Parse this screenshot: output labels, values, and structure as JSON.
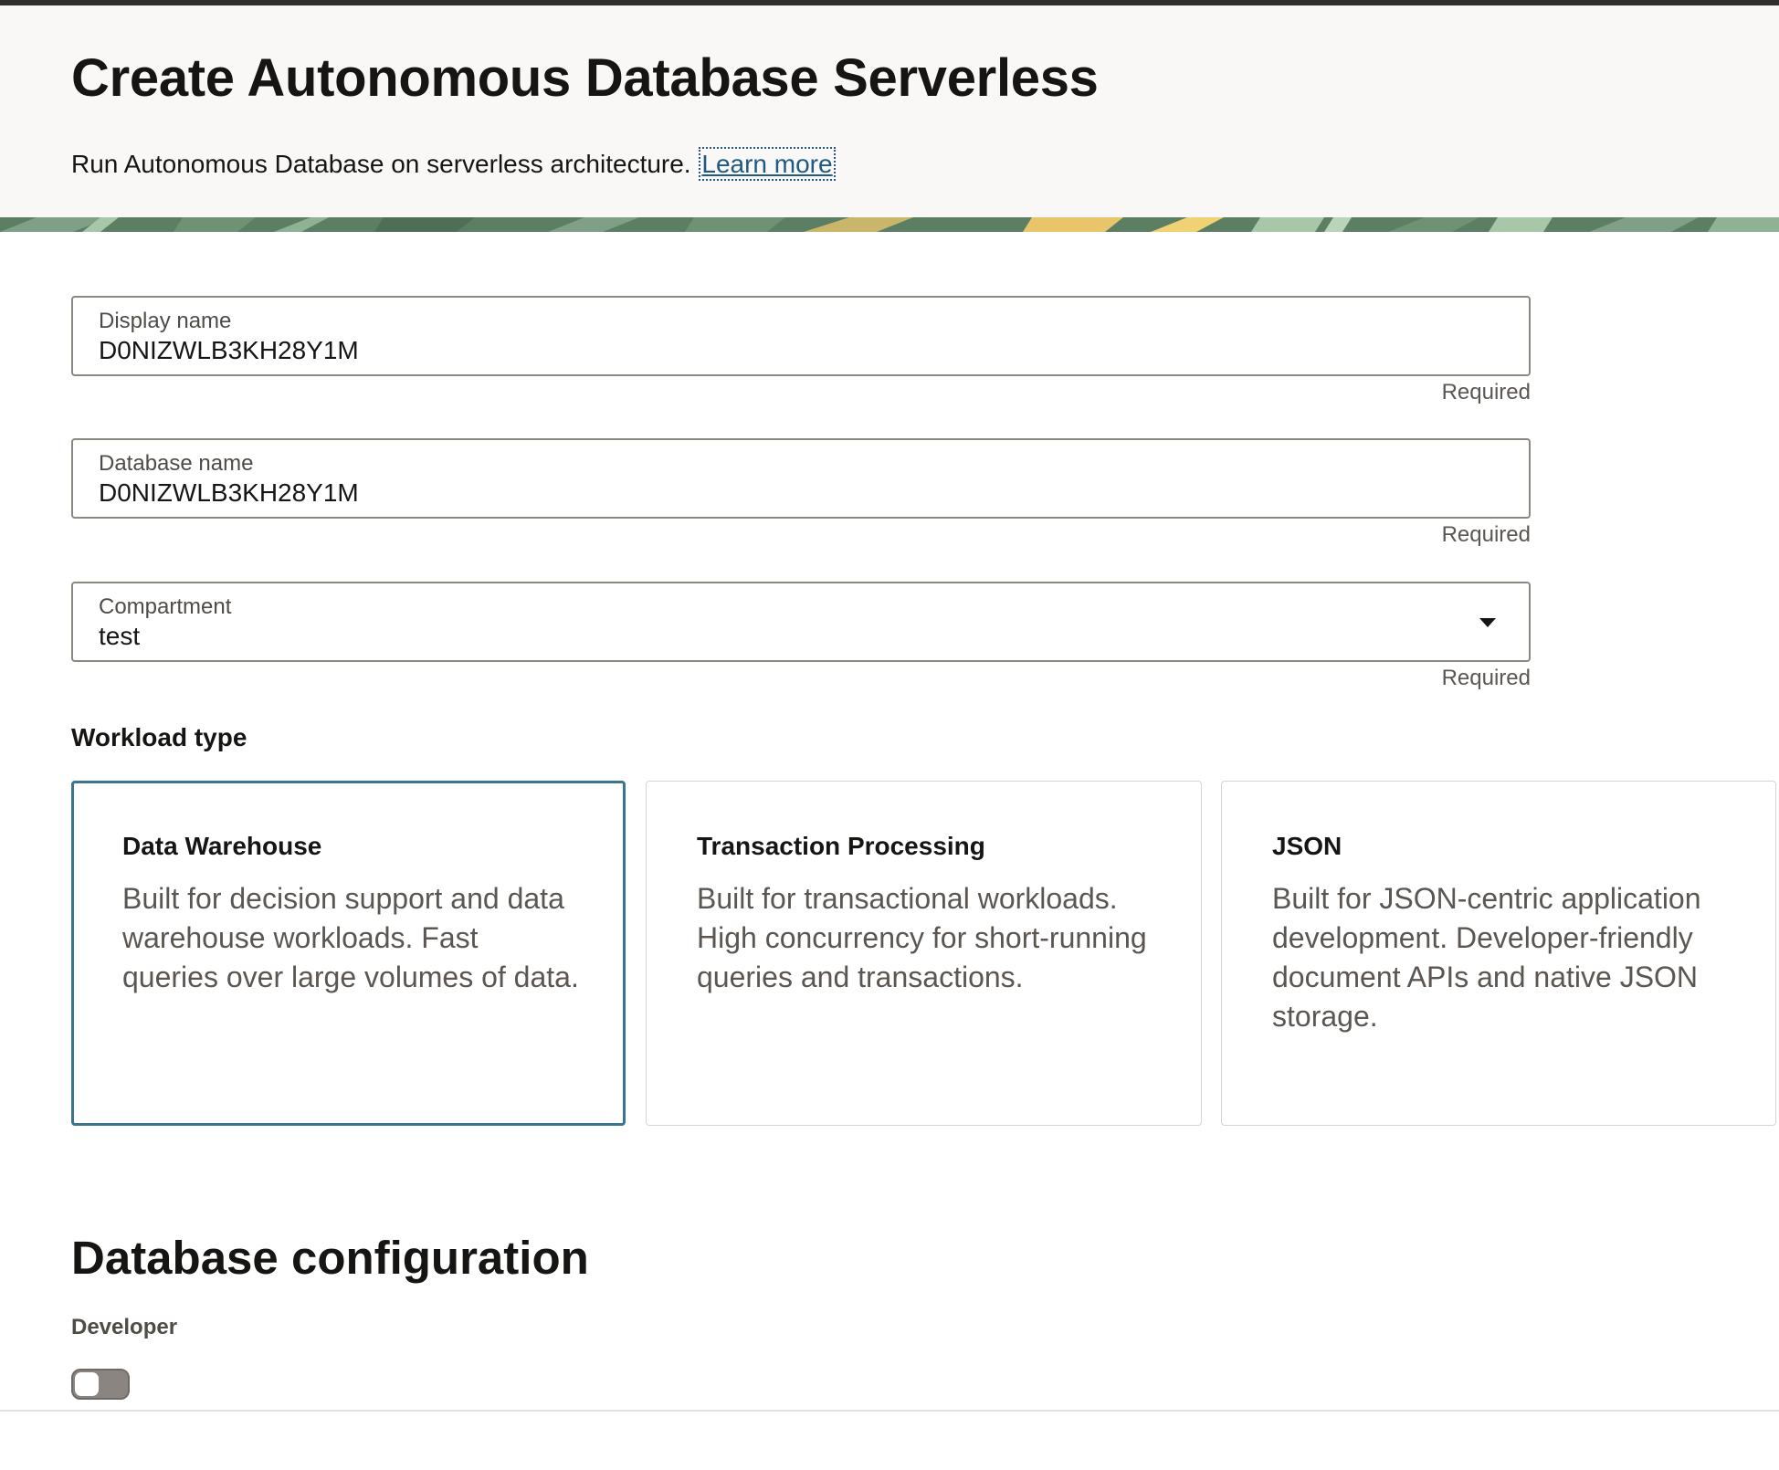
{
  "header": {
    "title": "Create Autonomous Database Serverless",
    "subtitle": "Run Autonomous Database on serverless architecture.",
    "learn_more": "Learn more"
  },
  "form": {
    "display_name": {
      "label": "Display name",
      "value": "D0NIZWLB3KH28Y1M",
      "hint": "Required"
    },
    "database_name": {
      "label": "Database name",
      "value": "D0NIZWLB3KH28Y1M",
      "hint": "Required"
    },
    "compartment": {
      "label": "Compartment",
      "value": "test",
      "hint": "Required",
      "icon": "chevron-down-icon"
    }
  },
  "workload": {
    "label": "Workload type",
    "selected": "Data Warehouse",
    "options": [
      {
        "title": "Data Warehouse",
        "description": "Built for decision support and data warehouse workloads. Fast queries over large volumes of data."
      },
      {
        "title": "Transaction Processing",
        "description": "Built for transactional workloads. High concurrency for short-running queries and transactions."
      },
      {
        "title": "JSON",
        "description": "Built for JSON-centric application development. Developer-friendly document APIs and native JSON storage."
      }
    ]
  },
  "config": {
    "title": "Database configuration",
    "developer_label": "Developer",
    "developer_enabled": false
  },
  "colors": {
    "accent": "#3c7390",
    "link": "#1e5a82",
    "header_bg": "#f9f8f6",
    "top_border": "#312d2a",
    "toggle_off": "#8a8580"
  }
}
